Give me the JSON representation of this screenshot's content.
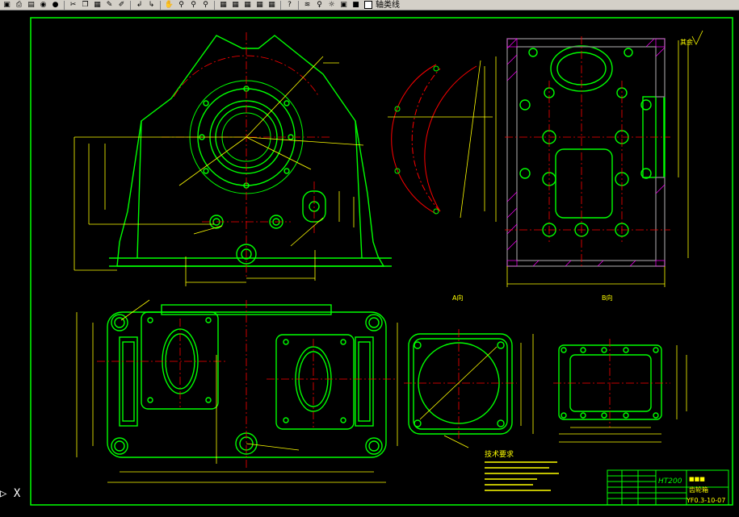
{
  "toolbar": {
    "buttons": [
      {
        "name": "save-icon",
        "glyph": "▣"
      },
      {
        "name": "print-icon",
        "glyph": "⎙"
      },
      {
        "name": "preview-icon",
        "glyph": "▤"
      },
      {
        "name": "publish-icon",
        "glyph": "◉"
      },
      {
        "name": "globe-icon",
        "glyph": "●"
      },
      {
        "name": "cut-icon",
        "glyph": "✂"
      },
      {
        "name": "copy-icon",
        "glyph": "❐"
      },
      {
        "name": "paste-icon",
        "glyph": "▦"
      },
      {
        "name": "match-properties-icon",
        "glyph": "✎"
      },
      {
        "name": "block-editor-icon",
        "glyph": "✐"
      },
      {
        "name": "undo-icon",
        "glyph": "↲"
      },
      {
        "name": "redo-icon",
        "glyph": "↳"
      },
      {
        "name": "pan-icon",
        "glyph": "✋"
      },
      {
        "name": "zoom-realtime-icon",
        "glyph": "⚲"
      },
      {
        "name": "zoom-window-icon",
        "glyph": "⚲"
      },
      {
        "name": "zoom-previous-icon",
        "glyph": "⚲"
      },
      {
        "name": "properties-icon",
        "glyph": "▦"
      },
      {
        "name": "design-center-icon",
        "glyph": "▦"
      },
      {
        "name": "tool-palettes-icon",
        "glyph": "▦"
      },
      {
        "name": "markup-icon",
        "glyph": "▦"
      },
      {
        "name": "calculator-icon",
        "glyph": "▦"
      },
      {
        "name": "help-icon",
        "glyph": "?"
      },
      {
        "name": "layer-icon",
        "glyph": "≋"
      },
      {
        "name": "layer-on-icon",
        "glyph": "♀"
      },
      {
        "name": "layer-freeze-icon",
        "glyph": "☼"
      },
      {
        "name": "layer-lock-icon",
        "glyph": "▣"
      },
      {
        "name": "layer-color-icon",
        "glyph": "■"
      }
    ],
    "layer_name": "轴类线"
  },
  "command_line": {
    "prompt": "▷ X"
  },
  "drawing": {
    "material_label": "HT200",
    "part_name": "齿轮箱",
    "drawing_number": "YF0.3-10-07",
    "view_a_label": "A向",
    "view_b_label": "B向",
    "tech_requirements_title": "技术要求",
    "roughness_label": "其余"
  },
  "colors": {
    "border": "#00ff00",
    "outline": "#00ff00",
    "center_line": "#ff0000",
    "dimension": "#ffff00",
    "hatch": "#ff00ff",
    "hole": "#00ff00",
    "background": "#000000",
    "toolbar_bg": "#d4d0c8"
  }
}
